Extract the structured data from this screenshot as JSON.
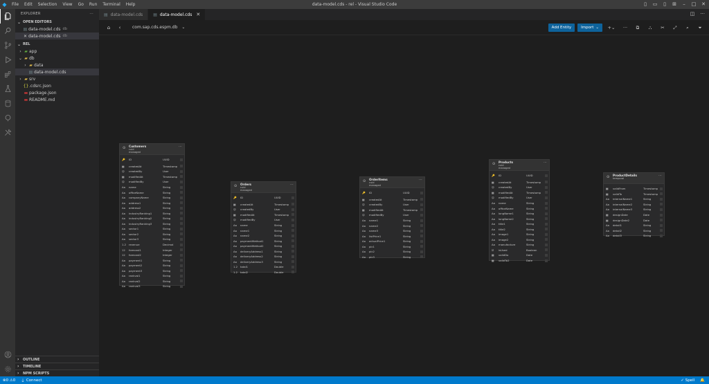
{
  "titlebar": {
    "menu": [
      "File",
      "Edit",
      "Selection",
      "View",
      "Go",
      "Run",
      "Terminal",
      "Help"
    ],
    "window_title": "data-model.cds - rel - Visual Studio Code"
  },
  "sidebar": {
    "title": "EXPLORER",
    "open_editors": {
      "label": "OPEN EDITORS",
      "items": [
        {
          "name": "data-model.cds",
          "desc": "db"
        },
        {
          "name": "data-model.cds",
          "desc": "db"
        }
      ]
    },
    "folder": {
      "label": "REL",
      "tree": {
        "app": "app",
        "db": "db",
        "data": "data",
        "data_model": "data-model.cds",
        "srv": "srv",
        "cdsrc": ".cdsrc.json",
        "package": "package.json",
        "readme": "README.md"
      }
    },
    "bottom": {
      "outline": "OUTLINE",
      "timeline": "TIMELINE",
      "npm": "NPM SCRIPTS"
    }
  },
  "tabs": [
    {
      "label": "data-model.cds"
    },
    {
      "label": "data-model.cds"
    }
  ],
  "toolbar": {
    "namespace": "com.sap.cds.espm.db",
    "add_entity": "Add Entity",
    "import": "Import"
  },
  "entities": {
    "customers": {
      "name": "Customers",
      "aspects": "cuid\nmanaged",
      "fields": [
        {
          "icon": "🔑",
          "name": "ID",
          "type": "UUID"
        },
        {
          "icon": "▦",
          "name": "createdAt",
          "type": "Timestamp"
        },
        {
          "icon": "☺",
          "name": "createdBy",
          "type": "User"
        },
        {
          "icon": "▦",
          "name": "modifiedAt",
          "type": "Timestamp"
        },
        {
          "icon": "☺",
          "name": "modifiedBy",
          "type": "User"
        },
        {
          "icon": "Aa",
          "name": "name",
          "type": "String"
        },
        {
          "icon": "Aa",
          "name": "officeName",
          "type": "String"
        },
        {
          "icon": "Aa",
          "name": "companyName",
          "type": "String"
        },
        {
          "icon": "Aa",
          "name": "address1",
          "type": "String"
        },
        {
          "icon": "Aa",
          "name": "address2",
          "type": "String"
        },
        {
          "icon": "Aa",
          "name": "industryRanking1",
          "type": "String"
        },
        {
          "icon": "Aa",
          "name": "industryRanking2",
          "type": "String"
        },
        {
          "icon": "Aa",
          "name": "industryRanking3",
          "type": "String"
        },
        {
          "icon": "Aa",
          "name": "sector1",
          "type": "String"
        },
        {
          "icon": "Aa",
          "name": "sector2",
          "type": "String"
        },
        {
          "icon": "Aa",
          "name": "sector3",
          "type": "String"
        },
        {
          "icon": "1.2",
          "name": "revenue",
          "type": "Decimal"
        },
        {
          "icon": "12",
          "name": "forecast1",
          "type": "Integer"
        },
        {
          "icon": "12",
          "name": "forecast2",
          "type": "Integer"
        },
        {
          "icon": "Aa",
          "name": "payment1",
          "type": "String"
        },
        {
          "icon": "Aa",
          "name": "payment2",
          "type": "String"
        },
        {
          "icon": "Aa",
          "name": "payment3",
          "type": "String"
        },
        {
          "icon": "Aa",
          "name": "rankval1",
          "type": "String"
        },
        {
          "icon": "Aa",
          "name": "rankval2",
          "type": "String"
        },
        {
          "icon": "Aa",
          "name": "rankval3",
          "type": "String"
        }
      ]
    },
    "orders": {
      "name": "Orders",
      "aspects": "cuid\nmanaged",
      "fields": [
        {
          "icon": "🔑",
          "name": "ID",
          "type": "UUID"
        },
        {
          "icon": "▦",
          "name": "createdAt",
          "type": "Timestamp"
        },
        {
          "icon": "☺",
          "name": "createdBy",
          "type": "User"
        },
        {
          "icon": "▦",
          "name": "modifiedAt",
          "type": "Timestamp"
        },
        {
          "icon": "☺",
          "name": "modifiedBy",
          "type": "User"
        },
        {
          "icon": "Aa",
          "name": "name",
          "type": "String"
        },
        {
          "icon": "Aa",
          "name": "name1",
          "type": "String"
        },
        {
          "icon": "Aa",
          "name": "name2",
          "type": "String"
        },
        {
          "icon": "Aa",
          "name": "paymentMethod1",
          "type": "String"
        },
        {
          "icon": "Aa",
          "name": "paymentMethod2",
          "type": "String"
        },
        {
          "icon": "Aa",
          "name": "deliveryAddress1",
          "type": "String"
        },
        {
          "icon": "Aa",
          "name": "deliveryAddress2",
          "type": "String"
        },
        {
          "icon": "Aa",
          "name": "deliveryAddress3",
          "type": "String"
        },
        {
          "icon": "1.2",
          "name": "total1",
          "type": "Double"
        },
        {
          "icon": "1.2",
          "name": "total2",
          "type": "Double"
        }
      ]
    },
    "order_items": {
      "name": "OrderItems",
      "aspects": "cuid\nmanaged",
      "fields": [
        {
          "icon": "🔑",
          "name": "ID",
          "type": "UUID"
        },
        {
          "icon": "▦",
          "name": "createdAt",
          "type": "Timestamp"
        },
        {
          "icon": "☺",
          "name": "createdBy",
          "type": "User"
        },
        {
          "icon": "▦",
          "name": "modifiedAt",
          "type": "Timestamp"
        },
        {
          "icon": "☺",
          "name": "modifiedBy",
          "type": "User"
        },
        {
          "icon": "Aa",
          "name": "name1",
          "type": "String"
        },
        {
          "icon": "Aa",
          "name": "name2",
          "type": "String"
        },
        {
          "icon": "Aa",
          "name": "name3",
          "type": "String"
        },
        {
          "icon": "Aa",
          "name": "listPrice1",
          "type": "String"
        },
        {
          "icon": "Aa",
          "name": "actualPrice1",
          "type": "String"
        },
        {
          "icon": "Aa",
          "name": "pic1",
          "type": "String"
        },
        {
          "icon": "Aa",
          "name": "pic2",
          "type": "String"
        },
        {
          "icon": "Aa",
          "name": "pic3",
          "type": "String"
        }
      ]
    },
    "products": {
      "name": "Products",
      "aspects": "cuid\nmanaged",
      "fields": [
        {
          "icon": "🔑",
          "name": "ID",
          "type": "UUID"
        },
        {
          "icon": "▦",
          "name": "createdAt",
          "type": "Timestamp"
        },
        {
          "icon": "☺",
          "name": "createdBy",
          "type": "User"
        },
        {
          "icon": "▦",
          "name": "modifiedAt",
          "type": "Timestamp"
        },
        {
          "icon": "☺",
          "name": "modifiedBy",
          "type": "User"
        },
        {
          "icon": "Aa",
          "name": "name",
          "type": "String"
        },
        {
          "icon": "Aa",
          "name": "officeName",
          "type": "String"
        },
        {
          "icon": "Aa",
          "name": "longName1",
          "type": "String"
        },
        {
          "icon": "Aa",
          "name": "longName2",
          "type": "String"
        },
        {
          "icon": "Aa",
          "name": "title1",
          "type": "String"
        },
        {
          "icon": "Aa",
          "name": "title2",
          "type": "String"
        },
        {
          "icon": "Aa",
          "name": "image1",
          "type": "String"
        },
        {
          "icon": "Aa",
          "name": "image2",
          "type": "String"
        },
        {
          "icon": "Aa",
          "name": "manufacture",
          "type": "String"
        },
        {
          "icon": "☑",
          "name": "isUsed",
          "type": "Boolean"
        },
        {
          "icon": "▦",
          "name": "validDo",
          "type": "Date"
        },
        {
          "icon": "▦",
          "name": "validTo2",
          "type": "Date"
        }
      ]
    },
    "product_details": {
      "name": "ProductDetails",
      "aspects": "temporal",
      "fields": [
        {
          "icon": "▦",
          "name": "validFrom",
          "type": "Timestamp"
        },
        {
          "icon": "▦",
          "name": "validTo",
          "type": "Timestamp"
        },
        {
          "icon": "Aa",
          "name": "internalName1",
          "type": "String"
        },
        {
          "icon": "Aa",
          "name": "internalName2",
          "type": "String"
        },
        {
          "icon": "Aa",
          "name": "internalName3",
          "type": "String"
        },
        {
          "icon": "▦",
          "name": "designDate",
          "type": "Date"
        },
        {
          "icon": "▦",
          "name": "designDate2",
          "type": "Date"
        },
        {
          "icon": "Aa",
          "name": "detail1",
          "type": "String"
        },
        {
          "icon": "Aa",
          "name": "detail2",
          "type": "String"
        },
        {
          "icon": "Aa",
          "name": "detail3",
          "type": "String"
        }
      ]
    }
  },
  "statusbar": {
    "problems": "⊗0 ⚠0",
    "connect": "Connect",
    "spell": "Spell"
  },
  "colors": {
    "accent": "#007acc",
    "button": "#0e639c",
    "canvas": "#1e1e1e",
    "card": "#2a2a2b"
  }
}
